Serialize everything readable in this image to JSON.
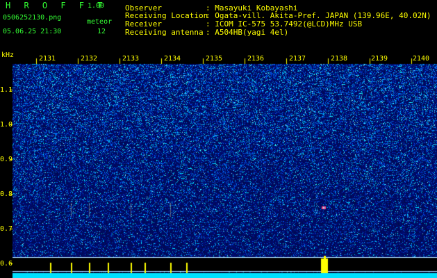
{
  "header": {
    "app_title": "H R O F F T",
    "version": "1.00",
    "filename": "0506252130.png",
    "datetime": "05.06.25 21:30",
    "meteor_label": "meteor",
    "meteor_count": "12",
    "meta": [
      {
        "label": "Observer",
        "value": ": Masayuki Kobayashi"
      },
      {
        "label": "Receiving Location",
        "value": ": Ogata-vill. Akita-Pref. JAPAN (139.96E, 40.02N)"
      },
      {
        "label": "Receiver",
        "value": ": ICOM IC-575 53.7492(@LCD)MHz USB"
      },
      {
        "label": "Receiving antenna",
        "value": ": A504HB(yagi 4el)"
      }
    ]
  },
  "spectrogram": {
    "y_unit": "kHz",
    "y_ticks": [
      "1.1",
      "1.0",
      "0.9",
      "0.8",
      "0.7",
      "0.6"
    ],
    "y_values": [
      1.1,
      1.0,
      0.9,
      0.8,
      0.7,
      0.6
    ],
    "x_ticks": [
      "2131",
      "2132",
      "2133",
      "2134",
      "2135",
      "2136",
      "2137",
      "2138",
      "2139",
      "2140"
    ],
    "colors": {
      "background": "#000000",
      "label": "#ffff00",
      "title": "#33ff33",
      "noise_dark": "#001a80",
      "noise_mid": "#0040ff",
      "noise_hot": "#00ffff",
      "meteor_echo": "#ff4080",
      "baseline": "#00e0ff",
      "meteor_bar": "#ffff00"
    },
    "meteor_echo": {
      "time": "2137.5",
      "freq_khz": 0.76
    }
  }
}
